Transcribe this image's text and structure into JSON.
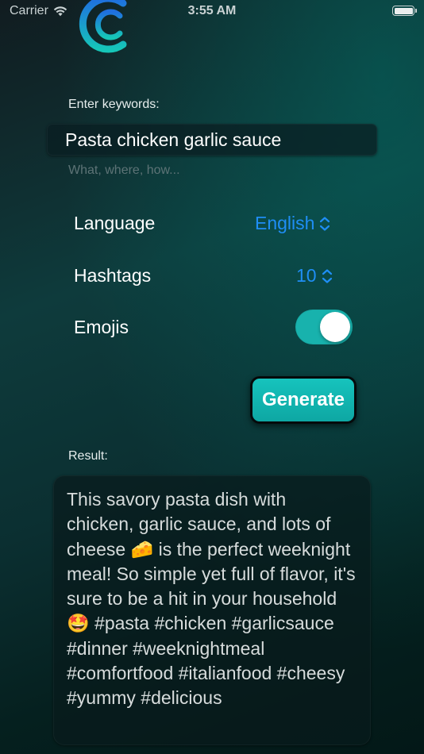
{
  "status_bar": {
    "carrier": "Carrier",
    "time": "3:55 AM"
  },
  "form": {
    "keywords_label": "Enter keywords:",
    "keywords_value": "Pasta chicken garlic sauce",
    "keywords_hint": "What, where, how...",
    "language_label": "Language",
    "language_value": "English",
    "hashtags_label": "Hashtags",
    "hashtags_value": "10",
    "emojis_label": "Emojis",
    "emojis_enabled": true,
    "generate_label": "Generate"
  },
  "result": {
    "label": "Result:",
    "text": "This savory pasta dish with chicken, garlic sauce, and lots of cheese 🧀 is the perfect weeknight meal! So simple yet full of flavor, it's sure to be a hit in your household 🤩 #pasta #chicken #garlicsauce #dinner #weeknightmeal #comfortfood #italianfood #cheesy #yummy #delicious"
  },
  "colors": {
    "accent": "#18b2ad",
    "picker_blue": "#1f8ef5",
    "background_dark": "#0b2f31"
  },
  "icons": {
    "wifi": "wifi-icon",
    "battery": "battery-icon",
    "logo": "app-logo",
    "picker_chevrons": "chevron-up-down-icon"
  }
}
